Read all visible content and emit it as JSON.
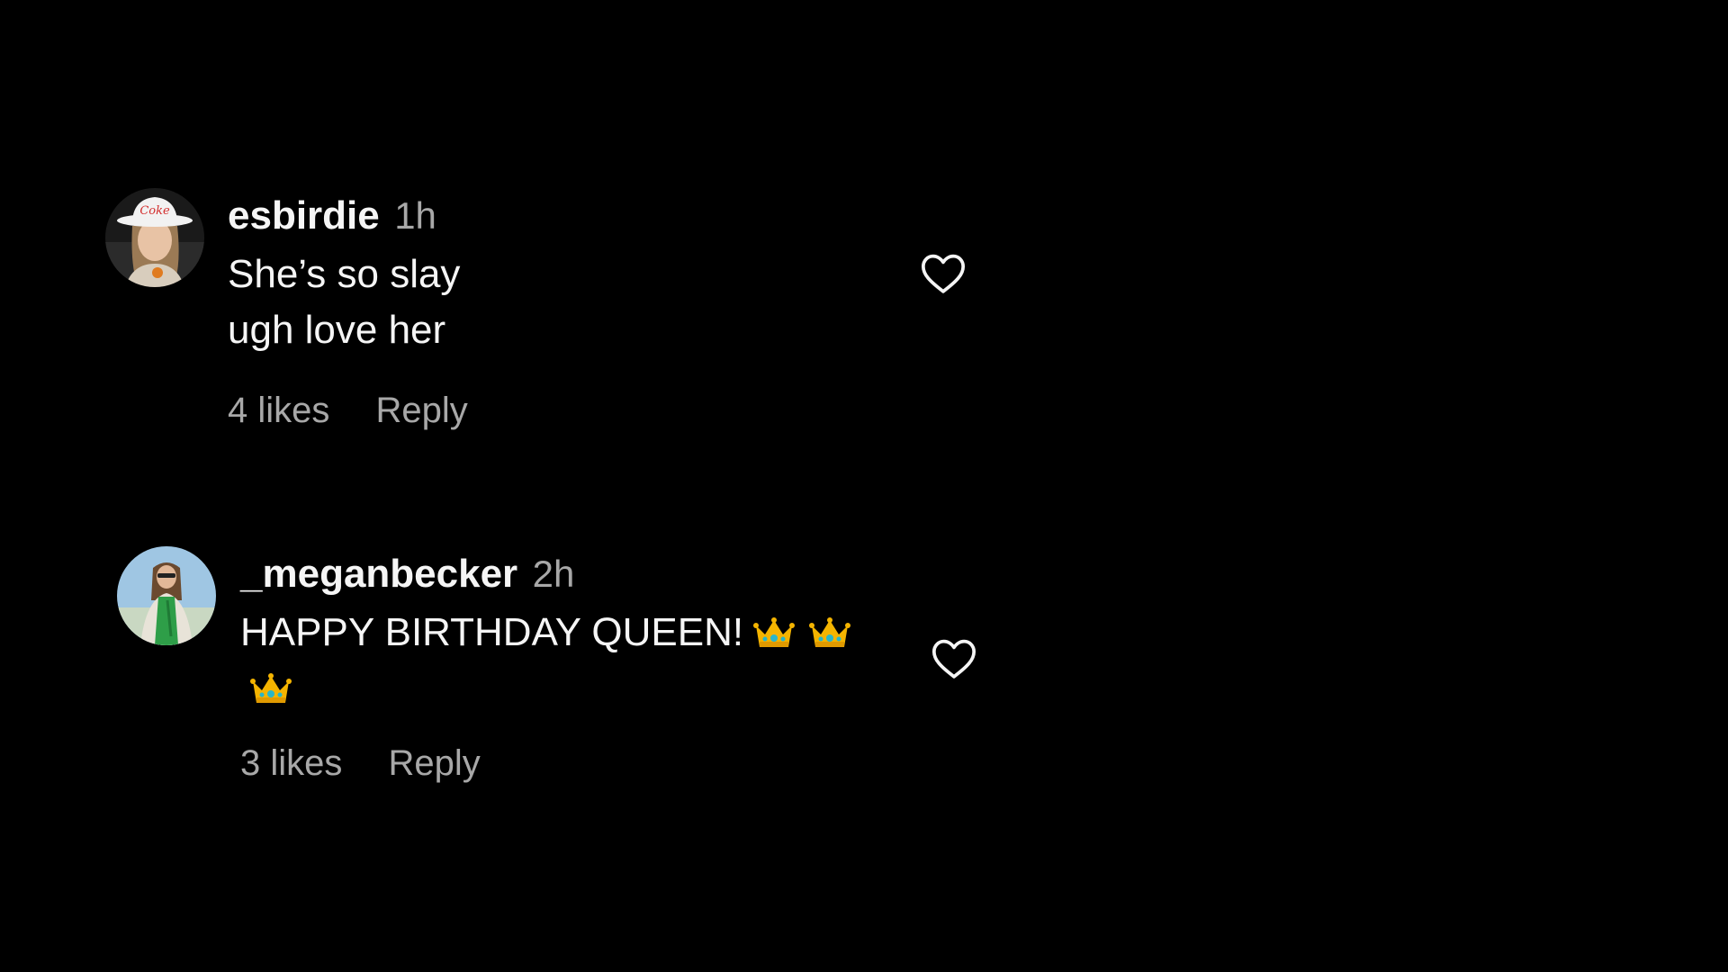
{
  "comments": [
    {
      "username": "esbirdie",
      "timestamp": "1h",
      "text": "She’s so slay ugh love her",
      "likes": "4 likes",
      "reply": "Reply",
      "avatar": "avatar-woman-white-cap"
    },
    {
      "username": "_meganbecker",
      "timestamp": "2h",
      "text": "HAPPY BIRTHDAY QUEEN!",
      "likes": "3 likes",
      "reply": "Reply",
      "avatar": "avatar-woman-green-outfit",
      "emoji": [
        "crown-emoji",
        "crown-emoji",
        "crown-emoji"
      ]
    }
  ],
  "icons": {
    "like": "heart-outline-icon"
  },
  "colors": {
    "background": "#000000",
    "primary_text": "#f5f5f5",
    "secondary_text": "#a8a8a8",
    "crown_gold": "#f4b400",
    "crown_gem": "#29b6c8"
  }
}
